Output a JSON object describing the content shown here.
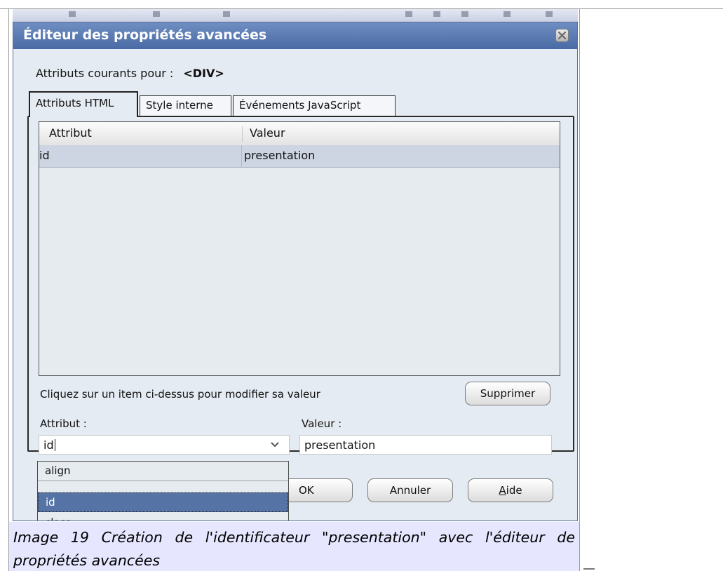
{
  "dialog": {
    "title": "Éditeur des propriétés avancées",
    "current_attrs_label": "Attributs courants pour :",
    "current_tag": "<DIV>",
    "tabs": [
      {
        "label": "Attributs HTML",
        "active": true
      },
      {
        "label": "Style interne",
        "active": false
      },
      {
        "label": "Événements JavaScript",
        "active": false
      }
    ],
    "table": {
      "headers": [
        "Attribut",
        "Valeur"
      ],
      "rows": [
        {
          "attribute": "id",
          "value": "presentation"
        }
      ]
    },
    "hint": "Cliquez sur un item ci-dessus pour modifier sa valeur",
    "delete_label": "Supprimer",
    "attribute_label": "Attribut :",
    "value_label": "Valeur :",
    "attribute_input": "id",
    "value_input": "presentation",
    "dropdown_options": [
      "align",
      "id",
      "class"
    ],
    "dropdown_selected": "id",
    "ok_label": "OK",
    "cancel_label": "Annuler",
    "help_label_accel": "A",
    "help_label_rest": "ide"
  },
  "caption": "Image 19 Création de l'identificateur \"presentation\" avec l'éditeur de propriétés avancées",
  "colors": {
    "titlebar": "#5a7ab5",
    "dialog_bg": "#e5ebf2",
    "selected_item": "#5573a5",
    "caption_bg": "#e6e6ff"
  },
  "icons": {
    "close": "close-icon",
    "dropdown": "chevron-down-icon"
  }
}
